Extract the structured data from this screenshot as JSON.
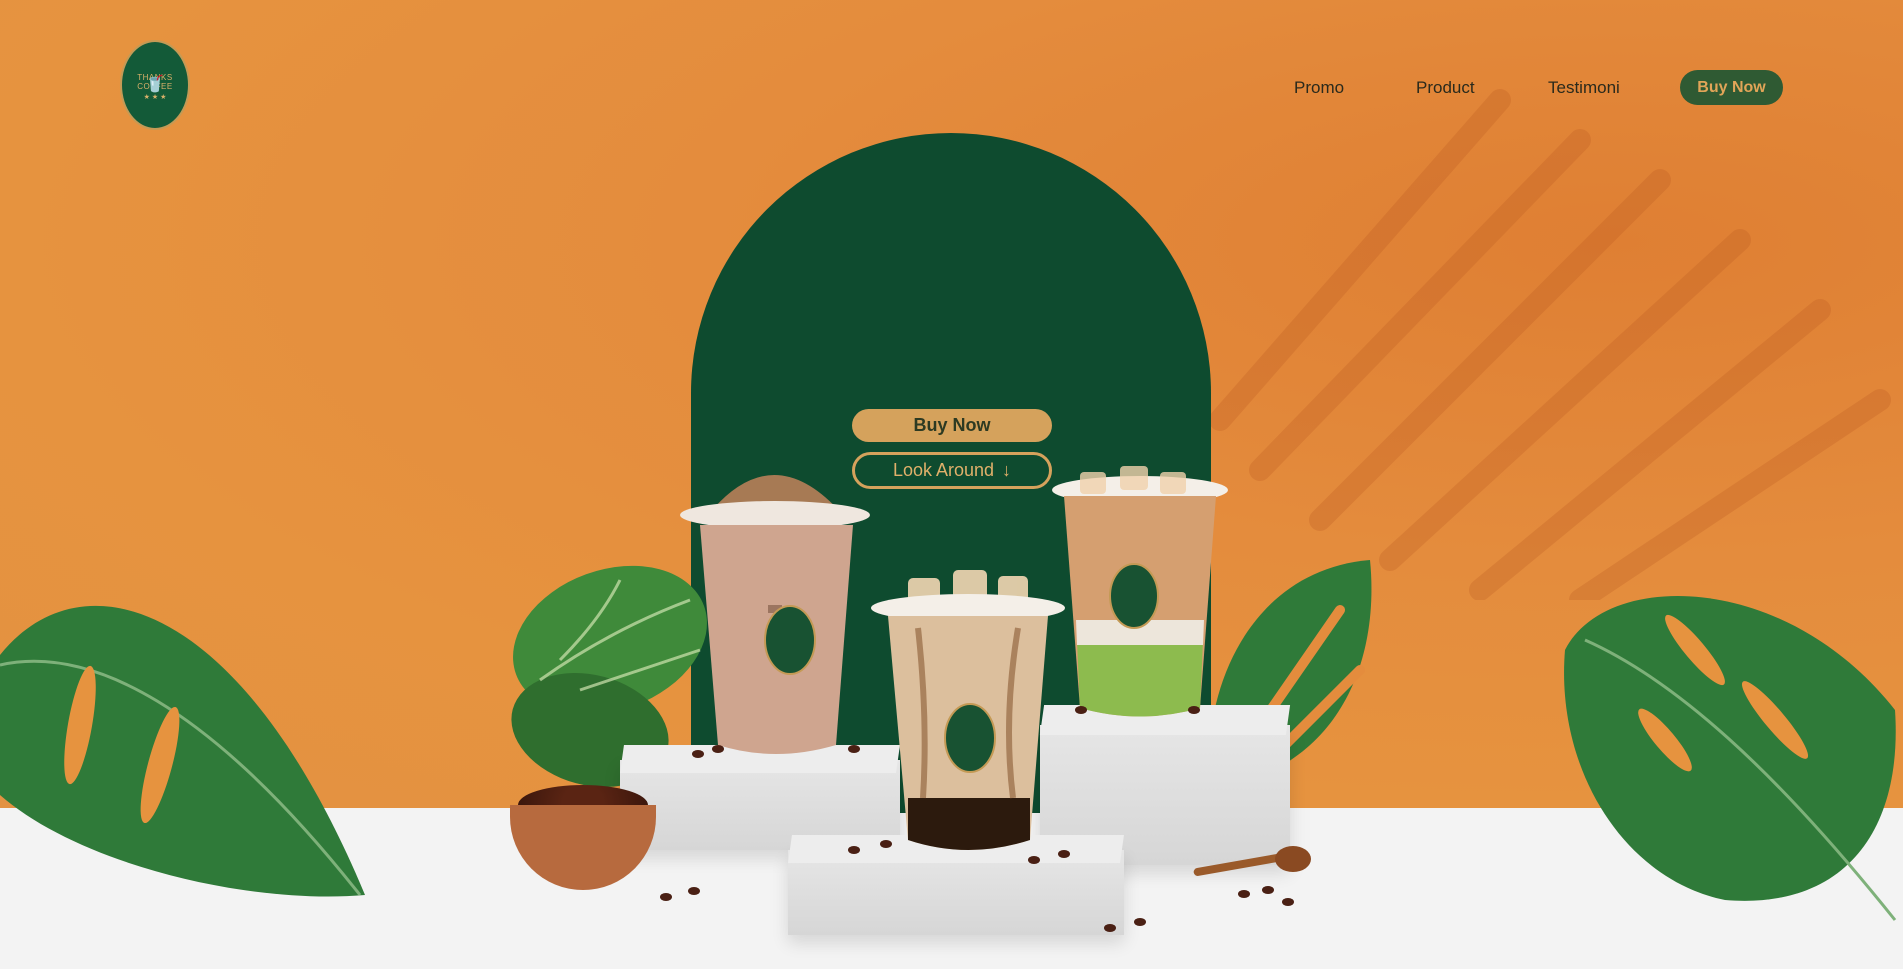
{
  "logo": {
    "line1": "THANKS",
    "line2": "COFFEE",
    "stars": "★ ★ ★"
  },
  "nav": {
    "items": [
      "Promo",
      "Product",
      "Testimoni"
    ],
    "buy_label": "Buy Now"
  },
  "hero": {
    "buy_label": "Buy Now",
    "look_label": "Look Around",
    "look_icon": "arrow-down-icon"
  },
  "colors": {
    "background": "#e6933f",
    "arch": "#0e4b2f",
    "accent": "#d5a25c",
    "nav_button": "#2f5a33",
    "floor": "#f3f3f3"
  }
}
